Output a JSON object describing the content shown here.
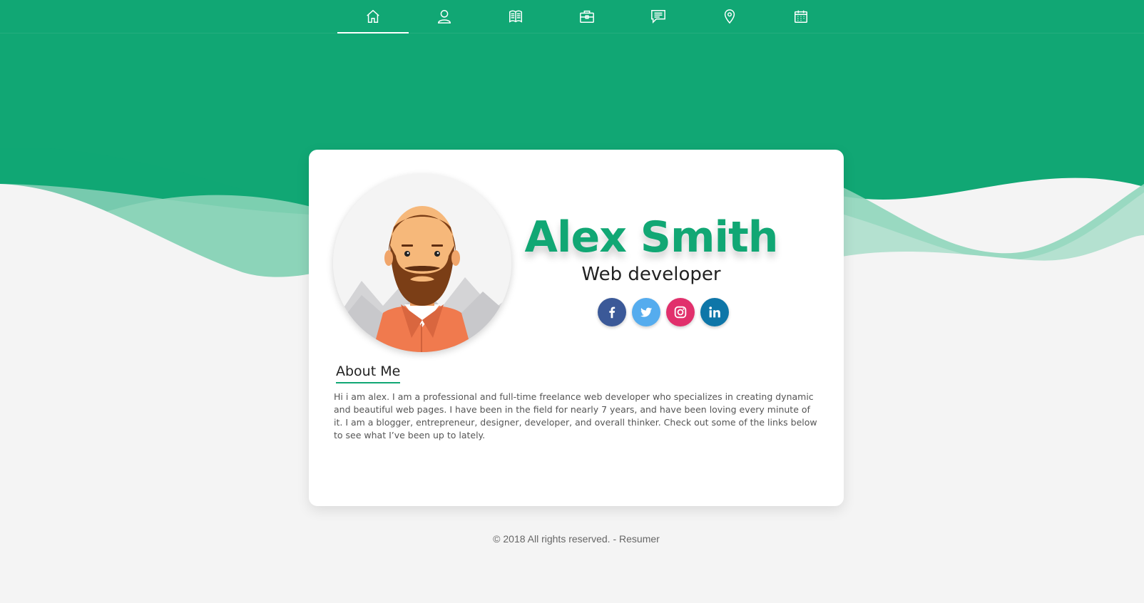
{
  "nav": {
    "items": [
      {
        "icon": "home-icon",
        "active": true
      },
      {
        "icon": "user-icon",
        "active": false
      },
      {
        "icon": "book-icon",
        "active": false
      },
      {
        "icon": "briefcase-icon",
        "active": false
      },
      {
        "icon": "chat-icon",
        "active": false
      },
      {
        "icon": "map-pin-icon",
        "active": false
      },
      {
        "icon": "calendar-icon",
        "active": false
      }
    ]
  },
  "profile": {
    "name": "Alex Smith",
    "role": "Web developer",
    "socials": [
      {
        "icon": "facebook-icon",
        "color": "#3b5998"
      },
      {
        "icon": "twitter-icon",
        "color": "#55acee"
      },
      {
        "icon": "instagram-icon",
        "color": "#e1306c"
      },
      {
        "icon": "linkedin-icon",
        "color": "#0e76a8"
      }
    ]
  },
  "about": {
    "title": "About Me",
    "text": "Hi i am alex. I am a professional and full-time freelance web developer who specializes in creating dynamic and beautiful web pages. I have been in the field for nearly 7 years, and have been loving every minute of it. I am a blogger, entrepreneur, designer, developer, and overall thinker. Check out some of the links below to see what I’ve been up to lately."
  },
  "footer": {
    "text": "© 2018 All rights reserved. - Resumer"
  },
  "colors": {
    "accent": "#11a774",
    "background": "#f4f4f4"
  }
}
